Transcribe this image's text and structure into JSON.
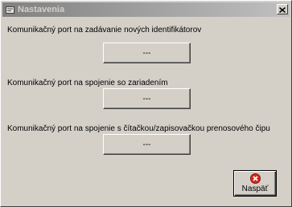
{
  "window": {
    "title": "Nastavenia",
    "title_icon": "app-settings-icon",
    "close_label": "×"
  },
  "settings": [
    {
      "label": "Komunikačný port na zadávanie nových identifikátorov",
      "value": "---"
    },
    {
      "label": "Komunikačný port na spojenie so zariadením",
      "value": "---"
    },
    {
      "label": "Komunikačný port na spojenie s čítačkou/zapisovačkou prenosového čipu",
      "value": "---"
    }
  ],
  "back_button": {
    "label": "Naspäť",
    "icon": "red-x-circle-icon"
  },
  "colors": {
    "face": "#d4d0c8",
    "title_inactive_start": "#808080",
    "title_inactive_end": "#c0c0c0",
    "back_icon_red": "#d9281c"
  }
}
